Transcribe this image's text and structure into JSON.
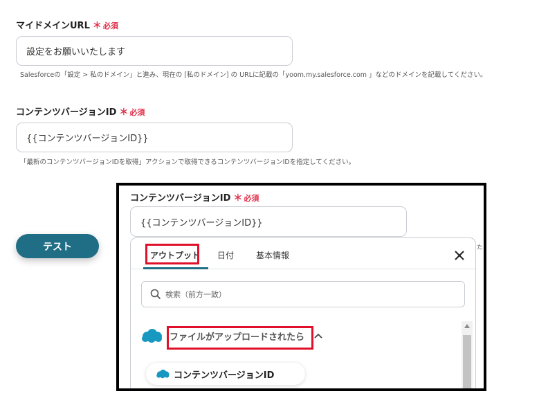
{
  "fields": [
    {
      "label": "マイドメインURL",
      "required_mark": "＊",
      "required_text": "必須",
      "value": "設定をお願いいたします",
      "hint": "Salesforceの「設定 > 私のドメイン」と進み、現在の [私のドメイン] の URLに記載の「yoom.my.salesforce.com 」などのドメインを記載してください。"
    },
    {
      "label": "コンテンツバージョンID",
      "required_mark": "＊",
      "required_text": "必須",
      "value": "{{コンテンツバージョンID}}",
      "hint": "「最新のコンテンツバージョンIDを取得」アクションで取得できるコンテンツバージョンIDを指定してください。"
    }
  ],
  "test_button": "テスト",
  "inset": {
    "label": "コンテンツバージョンID",
    "required_mark": "＊",
    "required_text": "必須",
    "value": "{{コンテンツバージョンID}}",
    "cut_char": "た",
    "tabs": [
      {
        "label": "アウトプット",
        "active": true
      },
      {
        "label": "日付",
        "active": false
      },
      {
        "label": "基本情報",
        "active": false
      }
    ],
    "search_placeholder": "検索（前方一致）",
    "group_title": "ファイルがアップロードされたら",
    "item_label": "コンテンツバージョンID"
  },
  "colors": {
    "accent": "#1f6e86",
    "required": "#e0304a",
    "highlight": "#e0102a",
    "salesforce": "#1798c1"
  }
}
